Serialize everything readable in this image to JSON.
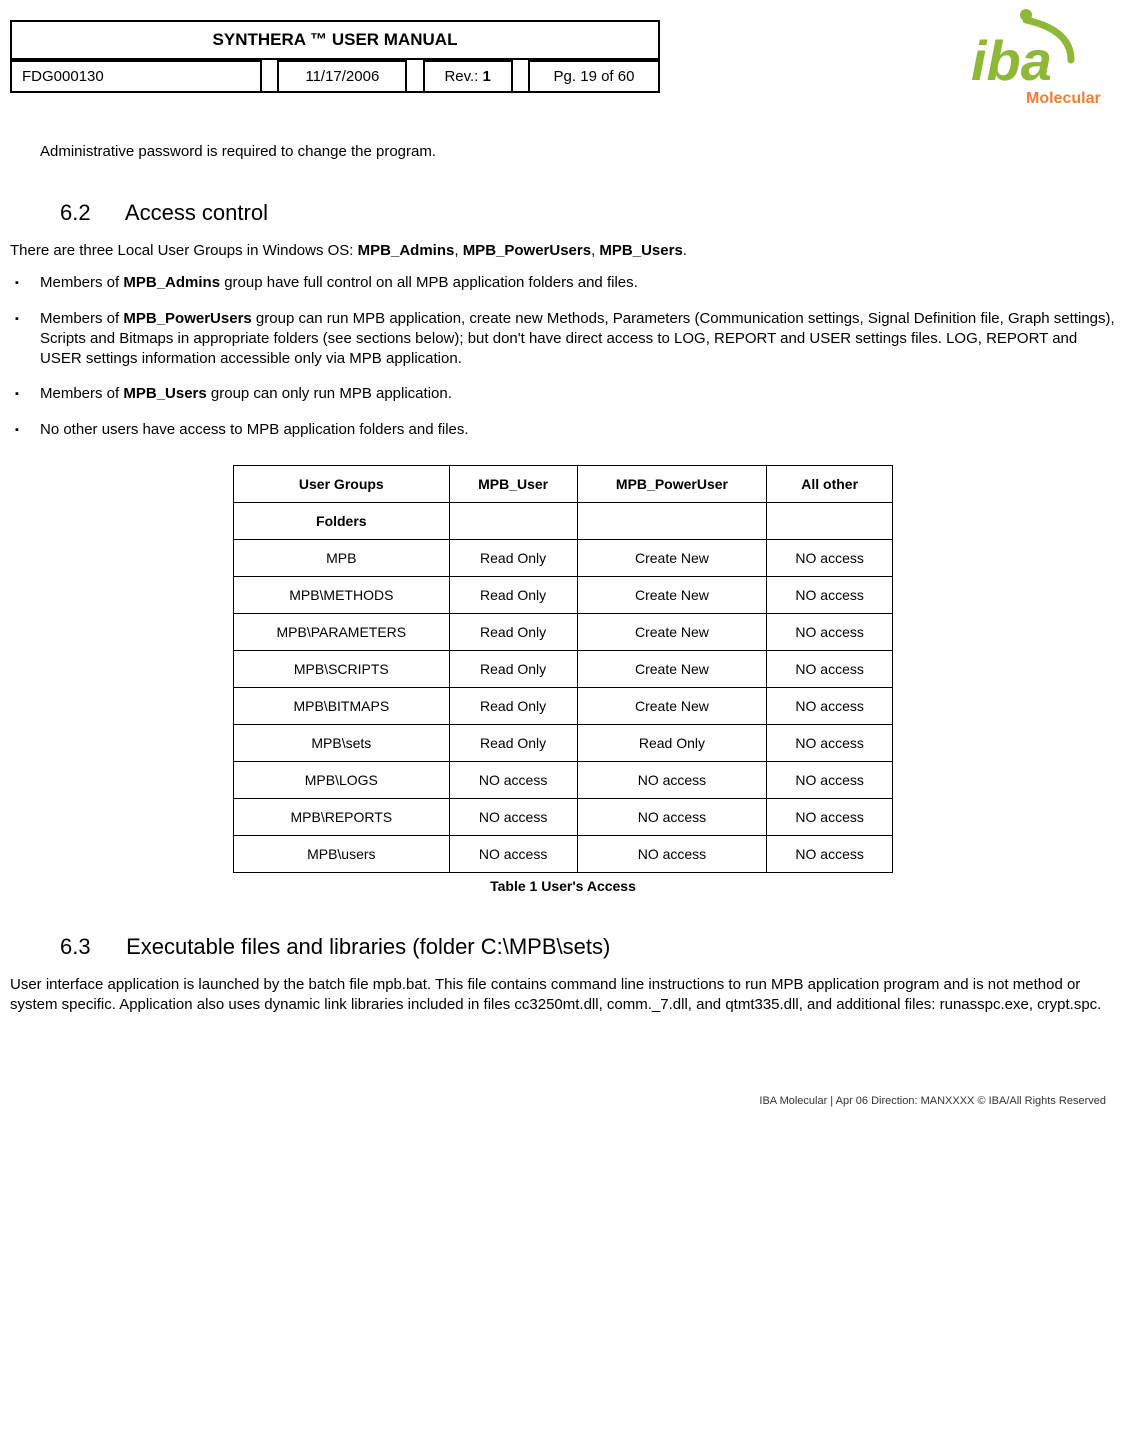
{
  "header": {
    "title": "SYNTHERA ™ USER MANUAL",
    "doc_id": "FDG000130",
    "date": "11/17/2006",
    "rev_label": "Rev.: ",
    "rev_value": "1",
    "page": "Pg. 19 of 60"
  },
  "logo": {
    "brand_top": "iba",
    "brand_bottom": "Molecular"
  },
  "intro": "Administrative password is required to change the program.",
  "section_6_2": {
    "number": "6.2",
    "title": "Access control",
    "lead_pre": "There are three Local User Groups in Windows OS: ",
    "g1": "MPB_Admins",
    "g2": "MPB_PowerUsers",
    "g3": "MPB_Users",
    "bullets": [
      {
        "pre": "Members of ",
        "bold": "MPB_Admins",
        "post": " group have full control on all MPB application folders and files."
      },
      {
        "pre": "Members of ",
        "bold": "MPB_PowerUsers",
        "post": " group can run MPB application, create new Methods, Parameters (Communication settings, Signal Definition file, Graph settings), Scripts and Bitmaps in appropriate folders (see sections below); but don't have direct access to LOG, REPORT and USER settings files. LOG, REPORT and USER settings information accessible only via MPB application."
      },
      {
        "pre": "Members of ",
        "bold": "MPB_Users",
        "post": " group can only run MPB application."
      },
      {
        "pre": "",
        "bold": "",
        "post": "No other users have access to MPB application folders and files."
      }
    ]
  },
  "access_table": {
    "header_row": [
      "User Groups",
      "MPB_User",
      "MPB_PowerUser",
      "All other"
    ],
    "folders_label": "Folders",
    "rows": [
      [
        "MPB",
        "Read Only",
        "Create New",
        "NO access"
      ],
      [
        "MPB\\METHODS",
        "Read Only",
        "Create New",
        "NO access"
      ],
      [
        "MPB\\PARAMETERS",
        "Read Only",
        "Create New",
        "NO access"
      ],
      [
        "MPB\\SCRIPTS",
        "Read Only",
        "Create New",
        "NO access"
      ],
      [
        "MPB\\BITMAPS",
        "Read Only",
        "Create New",
        "NO access"
      ],
      [
        "MPB\\sets",
        "Read Only",
        "Read Only",
        "NO access"
      ],
      [
        "MPB\\LOGS",
        "NO access",
        "NO access",
        "NO access"
      ],
      [
        "MPB\\REPORTS",
        "NO access",
        "NO access",
        "NO access"
      ],
      [
        "MPB\\users",
        "NO access",
        "NO access",
        "NO access"
      ]
    ],
    "caption": "Table 1 User's Access"
  },
  "section_6_3": {
    "number": "6.3",
    "title": "Executable files and libraries (folder C:\\MPB\\sets)",
    "body": "User interface application is launched by the batch file mpb.bat. This file contains command line instructions to run MPB application program and is not method or system specific. Application also uses dynamic link libraries included in files cc3250mt.dll, comm._7.dll, and qtmt335.dll, and additional files: runasspc.exe, crypt.spc."
  },
  "footer": "IBA Molecular | Apr 06 Direction: MANXXXX © IBA/All Rights Reserved"
}
